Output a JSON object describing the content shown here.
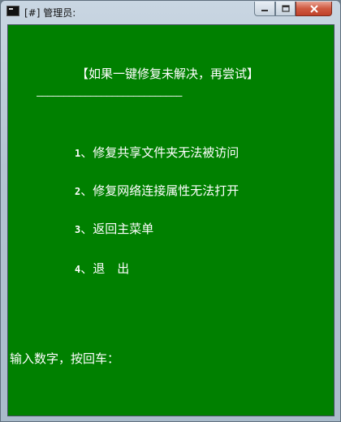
{
  "window": {
    "title": "[#] 管理员:",
    "controls": {
      "minimize_icon": "minimize-icon",
      "maximize_icon": "maximize-icon",
      "close_icon": "close-icon"
    }
  },
  "console": {
    "background_color": "#008000",
    "text_color": "#ffffff",
    "header": "【如果一键修复未解决，再尝试】",
    "separator": "———————————————————————————",
    "menu": [
      {
        "number": "1",
        "sep": "、",
        "label": "修复共享文件夹无法被访问"
      },
      {
        "number": "2",
        "sep": "、",
        "label": "修复网络连接属性无法打开"
      },
      {
        "number": "3",
        "sep": "、",
        "label": "返回主菜单"
      },
      {
        "number": "4",
        "sep": "、",
        "label": "退　出"
      }
    ],
    "prompt": "输入数字，按回车："
  }
}
